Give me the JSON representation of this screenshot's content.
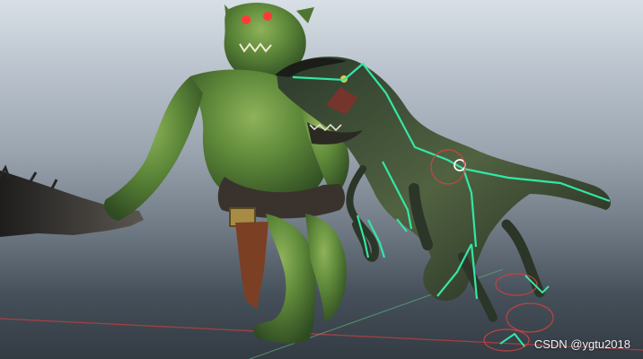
{
  "viewport": {
    "watermark": "CSDN @ygtu2018"
  },
  "scene": {
    "characters": [
      "orc",
      "raptor"
    ],
    "icons": [
      "orc-icon",
      "raptor-icon",
      "rig-control-icon",
      "club-icon"
    ]
  }
}
